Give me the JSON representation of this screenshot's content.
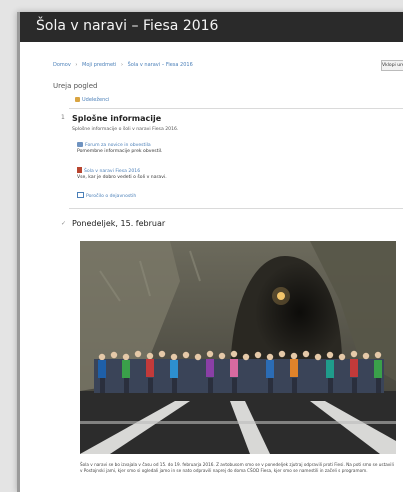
{
  "header": {
    "title": "Šola v naravi – Fiesa 2016"
  },
  "breadcrumb": {
    "items": [
      "Domov",
      "Moji predmeti",
      "Šola v naravi – Fiesa 2016"
    ],
    "separator": "›"
  },
  "toolbar": {
    "edit_label": "Vklopi urejanje"
  },
  "course": {
    "section_label": "Ureja pogled",
    "participants_label": "Udeleženci"
  },
  "general": {
    "toggle": "1",
    "title": "Splošne informacije",
    "description": "Splošne informacije o šoli v naravi Fiesa 2016.",
    "forum_link": "Forum za novice in obvestila",
    "forum_desc": "Pomembne informacije prek obvestil.",
    "file_link": "Šola v naravi Fiesa 2016",
    "file_desc": "Vse, kar je dobro vedeti o šoli v naravi.",
    "outline_link": "Poročilo o dejavnostih"
  },
  "day": {
    "toggle": "✓",
    "title": "Ponedeljek, 15. februar"
  },
  "caption": {
    "text": "Šola v naravi se bo izvajala v času od 15. do 19. februarja 2016. Z avtobusom smo se v ponedeljek zjutraj odpravili proti Fiesi. Na poti smo se ustavili v Postojnski jami, kjer smo si ogledali jamo in se nato odpravili naprej do doma CŠOD Fiesa, kjer smo se namestili in začeli s programom."
  }
}
